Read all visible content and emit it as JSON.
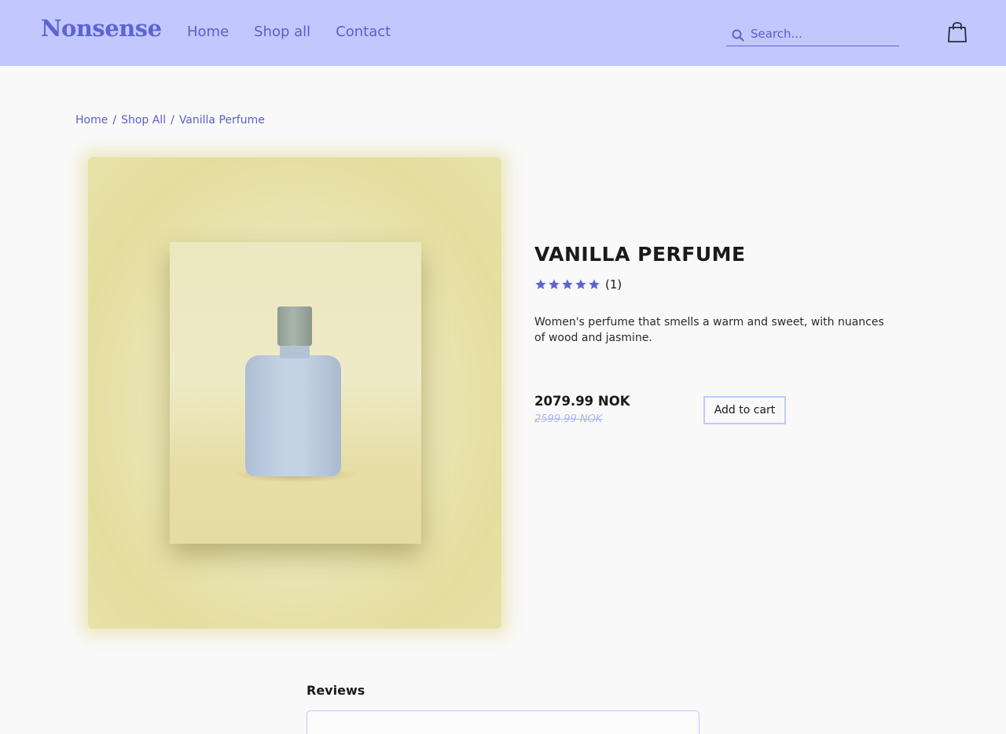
{
  "header": {
    "logo": "Nonsense",
    "nav": [
      "Home",
      "Shop all",
      "Contact"
    ],
    "search_placeholder": "Search..."
  },
  "breadcrumb": [
    "Home",
    "Shop All",
    "Vanilla Perfume"
  ],
  "product": {
    "title": "VANILLA PERFUME",
    "rating_stars": 5,
    "rating_count": "(1)",
    "description": "Women's perfume that smells a warm and sweet, with nuances of wood and jasmine.",
    "price": "2079.99 NOK",
    "old_price": "2599.99 NOK",
    "add_to_cart_label": "Add to cart"
  },
  "reviews": {
    "title": "Reviews"
  },
  "colors": {
    "header_bg": "#c2c8fd",
    "accent": "#5e63d4",
    "page_bg": "#f9f9f9"
  }
}
